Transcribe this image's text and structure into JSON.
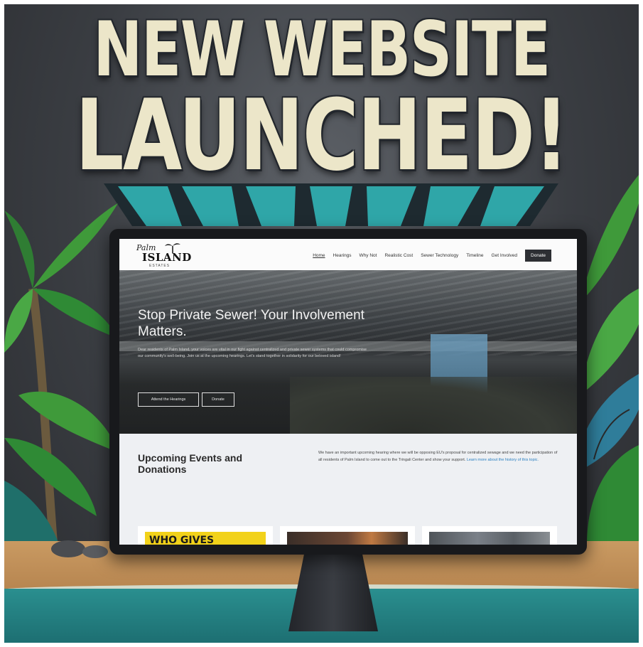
{
  "headline": {
    "line1": "NEW WEBSITE",
    "line2": "LAUNCHED!"
  },
  "site": {
    "logo": {
      "script": "Palm",
      "main": "ISLAND",
      "sub": "ESTATES"
    },
    "nav": {
      "items": [
        "Home",
        "Hearings",
        "Why Not",
        "Realistic Cost",
        "Sewer Technology",
        "Timeline",
        "Get Involved"
      ],
      "donate_label": "Donate"
    },
    "hero": {
      "title": "Stop Private Sewer! Your Involvement Matters.",
      "text": "Dear residents of Palm Island, your voices are vital in our fight against centralized and private sewer systems that could compromise our community's well-being. Join us at the upcoming hearings. Let's stand together in solidarity for our beloved island!",
      "button_primary": "Attend the Hearings",
      "button_secondary": "Donate"
    },
    "events": {
      "title": "Upcoming Events and Donations",
      "text": "We have an important upcoming hearing where we will be opposing EU's proposal for centralized sewage and we need the participation of all residents of Palm Island to come out to the Tringali Center and show your support.",
      "link": "Learn more about the history of this topic."
    },
    "cards": [
      {
        "caption": "WHO GIVES"
      }
    ]
  },
  "colors": {
    "headline": "#ece6c9",
    "burst": "#2fa6a8",
    "monitor": "#18191c",
    "sand": "#c99a62",
    "water": "#2a8f8f"
  }
}
